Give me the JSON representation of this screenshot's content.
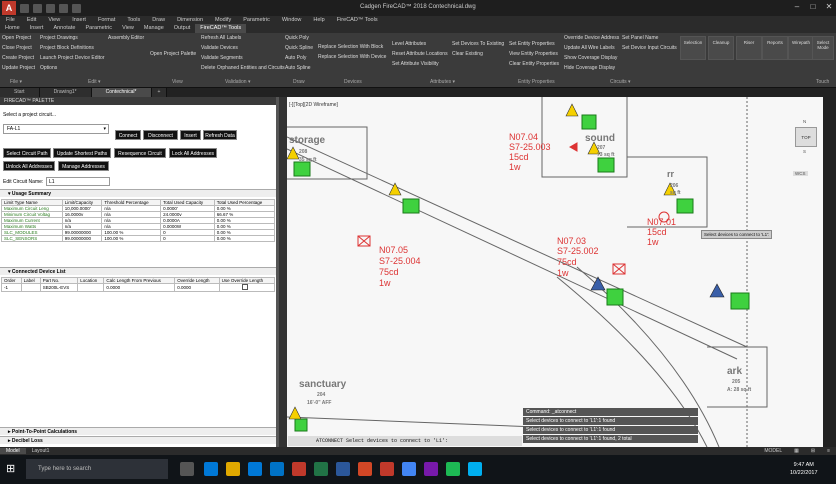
{
  "window": {
    "title": "Cadgen FireCAD™ 2018    Contechnical.dwg",
    "app_icon": "A"
  },
  "menubar": [
    "File",
    "Edit",
    "View",
    "Insert",
    "Format",
    "Tools",
    "Draw",
    "Dimension",
    "Modify",
    "Parametric",
    "Window",
    "Help",
    "FireCAD™ Tools"
  ],
  "tabs": [
    "Home",
    "Insert",
    "Annotate",
    "Parametric",
    "View",
    "Manage",
    "Output",
    "FireCAD™ Tools"
  ],
  "ribbon": {
    "file": [
      "Open Project",
      "Close Project",
      "Create Project",
      "Update Project"
    ],
    "edit": [
      "Project Drawings",
      "Project Block Definitions",
      "Launch Project Device Editor",
      "Options"
    ],
    "assembly": "Assembly Editor",
    "view": "Open Project Palette",
    "validation": [
      "Refresh All Labels",
      "Validate Devices",
      "Validate Segments",
      "Delete Orphaned Entities and Circuits"
    ],
    "draw": [
      "Quick Poly",
      "Quick Spline",
      "Auto Poly",
      "Auto Spline"
    ],
    "devices": [
      "Replace Selection With Block",
      "Replace Selection With Device"
    ],
    "attributes": [
      "Level Attributes",
      "Reset Attribute Locations",
      "Set Attribute Visibility",
      "Set Devices To Existing",
      "Clear Existing"
    ],
    "entity": [
      "Set Entity Properties",
      "View Entity Properties",
      "Clear Entity Properties"
    ],
    "circuits": [
      "Override Device Address",
      "Update All Wire Labels",
      "Show Coverage Display",
      "Hide Coverage Display",
      "Set Panel Name",
      "Set Device Input Circuits"
    ],
    "big": [
      "Selection",
      "Cleanup",
      "Riser",
      "Reports",
      "Wirepath",
      "Select Mode"
    ],
    "groups": [
      "File ▾",
      "Edit ▾",
      "View",
      "Validation ▾",
      "Draw",
      "Devices",
      "Attributes ▾",
      "Entity Properties",
      "Circuits ▾",
      "Touch"
    ]
  },
  "filetabs": [
    "Start",
    "Drawing1*",
    "Contechnical*"
  ],
  "palette": {
    "title": "FIRECAD™ PALETTE",
    "select_label": "Select a project circuit...",
    "circuit_value": "FA-L1",
    "btn_row1": [
      "Connect",
      "Disconnect",
      "Insert",
      "Refresh Data"
    ],
    "btn_row2": [
      "Select Circuit Path",
      "Update Shortest Paths",
      "Resequence Circuit",
      "Lock All Addresses"
    ],
    "btn_row3": [
      "Unlock All Addresses",
      "Manage Addresses"
    ],
    "edit_name_label": "Edit Circuit Name:",
    "edit_name_value": "L1",
    "usage_title": "Usage Summary",
    "usage_headers": [
      "Limit Type Name",
      "Limit/Capacity",
      "Threshold Percentage",
      "Total Used Capacity",
      "Total Used Percentage"
    ],
    "usage_rows": [
      [
        "Maximum Circuit Leng",
        "10,000.0000'",
        "n/a",
        "0.0000'",
        "0.00 %"
      ],
      [
        "Minimum Circuit Voltag",
        "16.0000v",
        "n/a",
        "24.0000v",
        "66.67 %"
      ],
      [
        "Maximum Current",
        "n/a",
        "n/a",
        "0.0000A",
        "0.00 %"
      ],
      [
        "Maximum Watts",
        "n/a",
        "n/a",
        "0.0000W",
        "0.00 %"
      ],
      [
        "SLC_MODULES",
        "99.00000000",
        "100.00 %",
        "0",
        "0.00 %"
      ],
      [
        "SLC_SENSORS",
        "99.00000000",
        "100.00 %",
        "0",
        "0.00 %"
      ]
    ],
    "connected_title": "Connected Device List",
    "conn_headers": [
      "Order",
      "Label",
      "Part No.",
      "Location",
      "Calc Length From Previous",
      "Override Length",
      "Use Override Length"
    ],
    "conn_rows": [
      [
        "-1",
        "",
        "SB200L-EVS",
        "",
        "0.0000",
        "0.0000",
        ""
      ]
    ],
    "footer_sections": [
      "Point-To-Point Calculations",
      "Decibel Loss"
    ]
  },
  "canvas": {
    "viewport_label": "[-][Top][2D Wireframe]",
    "rooms": [
      {
        "name": "storage",
        "num": "208",
        "area": "35 sq ft"
      },
      {
        "name": "sound",
        "num": "207",
        "area": "73 sq ft"
      },
      {
        "name": "rr",
        "num": "206",
        "area": "sq ft"
      },
      {
        "name": "sanctuary",
        "num": "204",
        "area": "16'-0\" AFF"
      },
      {
        "name": "ark",
        "num": "205",
        "area": "A: 28 sq ft"
      }
    ],
    "devices": [
      {
        "id": "N07.04",
        "addr": "S7-25.003",
        "cd": "15cd",
        "w": "1w"
      },
      {
        "id": "N07.05",
        "addr": "S7-25.004",
        "cd": "75cd",
        "w": "1w"
      },
      {
        "id": "N07.03",
        "addr": "S7-25.002",
        "cd": "75cd",
        "w": "1w"
      },
      {
        "id": "N07.01",
        "addr": "",
        "cd": "15cd",
        "w": "1w"
      }
    ],
    "tooltip": "Select devices to connect to 'L1':",
    "viewcube": {
      "top": "TOP",
      "n": "N",
      "s": "S",
      "wcs": "WCS"
    },
    "cmd_history": [
      "Command: _atconnect",
      "Select devices to connect to 'L1':1 found",
      "Select devices to connect to 'L1':1 found",
      "Select devices to connect to 'L1':1 found, 2 total"
    ],
    "cmd_prompt": "ATCONNECT Select devices to connect to 'L1':"
  },
  "status": {
    "layout_tabs": [
      "Model",
      "Layout1"
    ],
    "model": "MODEL"
  },
  "taskbar": {
    "search": "Type here to search",
    "time": "9:47 AM",
    "date": "10/22/2017"
  }
}
